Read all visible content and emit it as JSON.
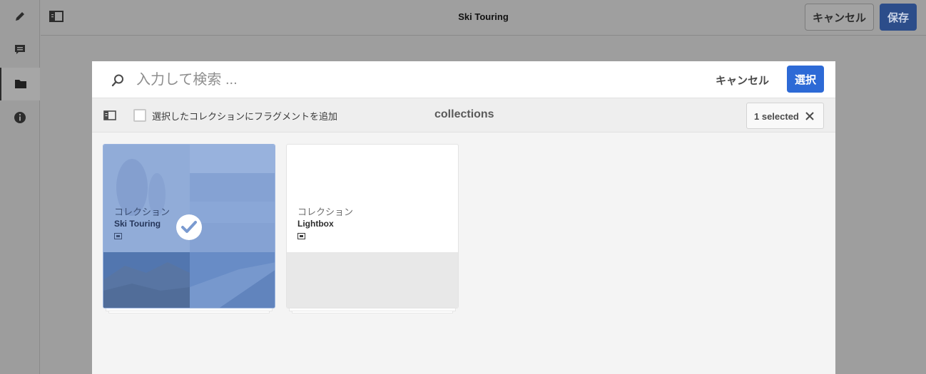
{
  "topbar": {
    "title": "Ski Touring",
    "cancel_label": "キャンセル",
    "save_label": "保存"
  },
  "rail": {
    "items": [
      "edit-icon",
      "comment-icon",
      "folder-icon",
      "info-icon"
    ],
    "active_index": 2
  },
  "dialog": {
    "search_placeholder": "入力して検索 ...",
    "cancel_label": "キャンセル",
    "select_label": "選択",
    "checkbox_label": "選択したコレクションにフラグメントを追加",
    "checkbox_checked": false,
    "title": "collections",
    "selected_count": "1 selected"
  },
  "cards": [
    {
      "type": "コレクション",
      "name": "Ski Touring",
      "selected": true
    },
    {
      "type": "コレクション",
      "name": "Lightbox",
      "selected": false
    }
  ],
  "colors": {
    "primary_blue": "#2d6ad6",
    "dim_save_blue": "#2c4d8a",
    "selection_overlay": "#648cd2"
  }
}
